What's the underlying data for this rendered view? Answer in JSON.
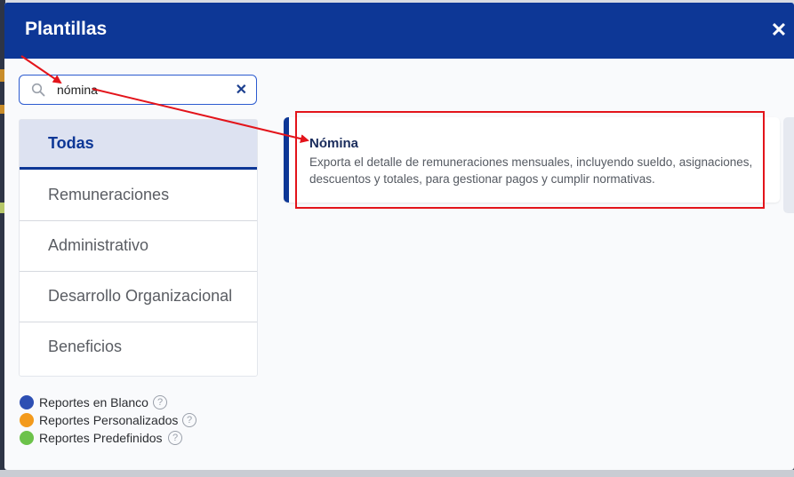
{
  "modal": {
    "title": "Plantillas",
    "close_icon": "close-icon"
  },
  "search": {
    "value": "nómina",
    "icon": "search-icon",
    "clear_icon": "clear-icon"
  },
  "categories": [
    {
      "label": "Todas",
      "active": true
    },
    {
      "label": "Remuneraciones",
      "active": false
    },
    {
      "label": "Administrativo",
      "active": false
    },
    {
      "label": "Desarrollo Organizacional",
      "active": false
    },
    {
      "label": "Beneficios",
      "active": false
    }
  ],
  "legend": [
    {
      "label": "Reportes en Blanco",
      "color": "#2d4fb3"
    },
    {
      "label": "Reportes Personalizados",
      "color": "#f39a1c"
    },
    {
      "label": "Reportes Predefinidos",
      "color": "#6cc24a"
    }
  ],
  "result": {
    "title": "Nómina",
    "description": "Exporta el detalle de remuneraciones mensuales, incluyendo sueldo, asignaciones, descuentos y totales, para gestionar pagos y cumplir normativas."
  },
  "colors": {
    "header": "#0d3796",
    "annotation": "#e3141b"
  }
}
